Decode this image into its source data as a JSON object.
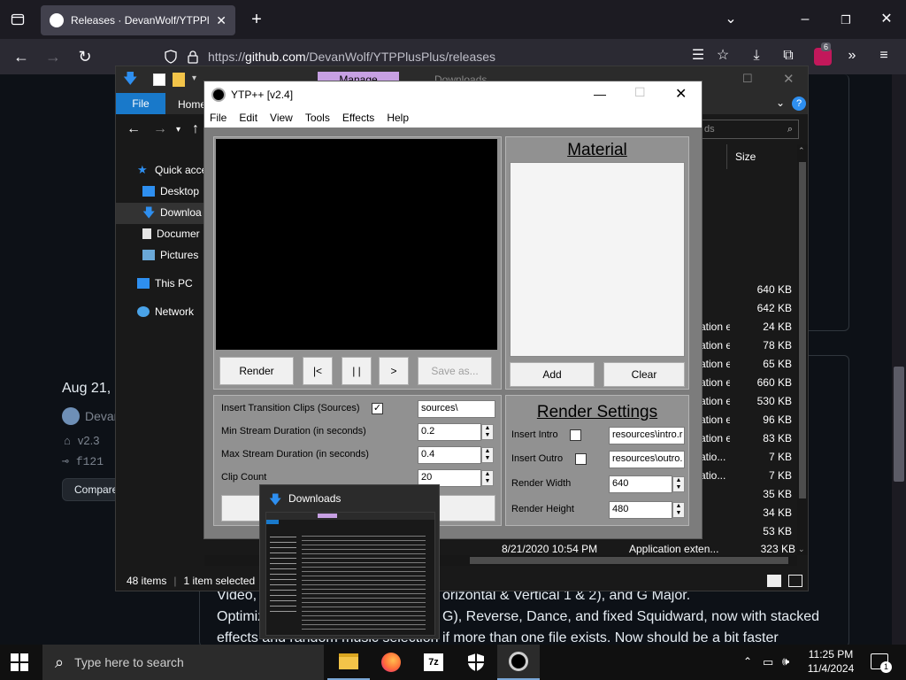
{
  "browser": {
    "tab_title": "Releases · DevanWolf/YTPPlusP",
    "url_prefix": "https://",
    "url_domain": "github.com",
    "url_path": "/DevanWolf/YTPPlusPlus/releases",
    "extensions_badge": "6"
  },
  "github": {
    "release_date": "Aug 21,",
    "author": "Devan",
    "tag": "v2.3",
    "commit": "f121",
    "compare_label": "Compare",
    "body_line1": "Video, E",
    "body_line1b": "orizontal & Vertical 1 & 2), and G Major.",
    "body_line2": "Optimiz",
    "body_line2b": "G), Reverse, Dance, and fixed Squidward, now with stacked",
    "body_line3": "effects and random music selection if more than one file exists. Now should be a bit faster"
  },
  "explorer": {
    "ribbon_file": "File",
    "ribbon_home": "Home",
    "ribbon_manage": "Manage",
    "ribbon_downloads": "Downloads",
    "search_placeholder": "ds",
    "column_size": "Size",
    "nav": [
      "Quick acce",
      "Desktop",
      "Downloa",
      "Documer",
      "Pictures",
      "This PC",
      "Network"
    ],
    "rows": [
      {
        "type": "",
        "size": "640 KB"
      },
      {
        "type": "",
        "size": "642 KB"
      },
      {
        "type": "ation exten...",
        "size": "24 KB"
      },
      {
        "type": "ation exten...",
        "size": "78 KB"
      },
      {
        "type": "ation exten...",
        "size": "65 KB"
      },
      {
        "type": "ation exten...",
        "size": "660 KB"
      },
      {
        "type": "ation exten...",
        "size": "530 KB"
      },
      {
        "type": "ation exten...",
        "size": "96 KB"
      },
      {
        "type": "ation exten...",
        "size": "83 KB"
      },
      {
        "type": "atio...",
        "size": "7 KB"
      },
      {
        "type": "atio...",
        "size": "7 KB"
      },
      {
        "type": "",
        "size": "35 KB"
      },
      {
        "type": "",
        "size": "34 KB"
      },
      {
        "type": "",
        "size": "53 KB"
      }
    ],
    "last_row_date": "8/21/2020 10:54 PM",
    "last_row_type": "Application exten...",
    "last_row_size": "323 KB",
    "status_items": "48 items",
    "status_selected": "1 item selected"
  },
  "ytp": {
    "title": "YTP++ [v2.4]",
    "menu": [
      "File",
      "Edit",
      "View",
      "Tools",
      "Effects",
      "Help"
    ],
    "render": "Render",
    "first": "|<",
    "pause": "| |",
    "next": ">",
    "save_as": "Save as...",
    "material_title": "Material",
    "add": "Add",
    "clear": "Clear",
    "insert_transition": "Insert Transition Clips (Sources)",
    "transition_path": "sources\\",
    "min_stream": "Min Stream Duration (in seconds)",
    "min_stream_value": "0.2",
    "max_stream": "Max Stream Duration (in seconds)",
    "max_stream_value": "0.4",
    "clip_count": "Clip Count",
    "clip_count_value": "20",
    "render_settings_title": "Render Settings",
    "insert_intro": "Insert Intro",
    "intro_path": "resources\\intro.r",
    "insert_outro": "Insert Outro",
    "outro_path": "resources\\outro.",
    "render_width": "Render Width",
    "render_width_value": "640",
    "render_height": "Render Height",
    "render_height_value": "480"
  },
  "thumbnail": {
    "title": "Downloads"
  },
  "taskbar": {
    "search_placeholder": "Type here to search",
    "time": "11:25 PM",
    "date": "11/4/2024",
    "notification_count": "1"
  },
  "colors": {
    "accent_blue": "#1979ca",
    "manage_tab": "#c7a0e3"
  }
}
